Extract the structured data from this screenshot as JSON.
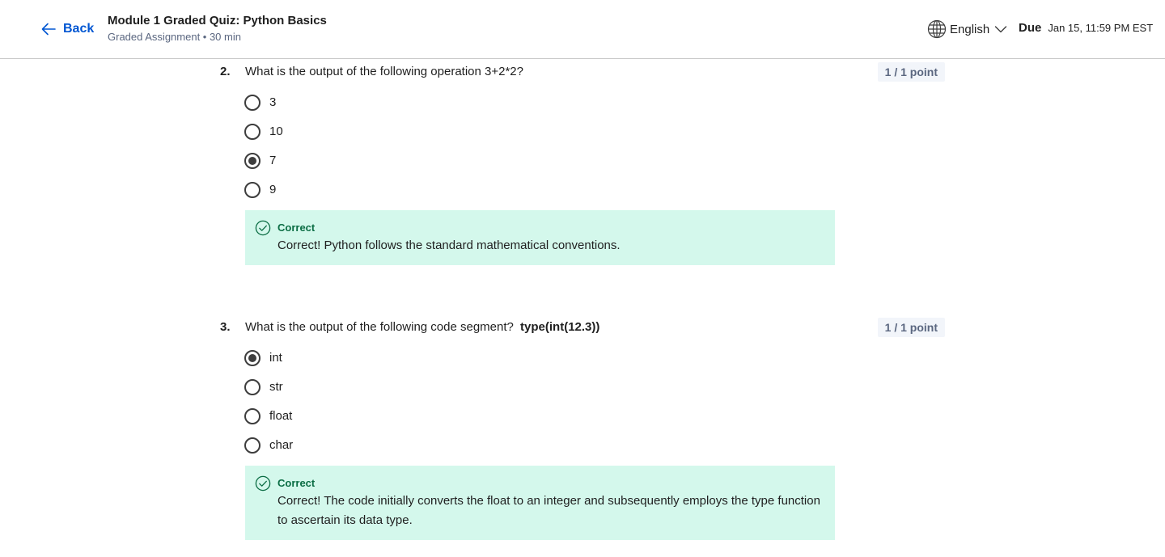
{
  "header": {
    "back_label": "Back",
    "title": "Module 1 Graded Quiz: Python Basics",
    "subtitle": "Graded Assignment • 30 min",
    "language": "English",
    "due_label": "Due",
    "due_date": "Jan 15, 11:59 PM EST"
  },
  "questions": [
    {
      "number": "2.",
      "text": "What is the output of the following operation 3+2*2?",
      "code": "",
      "points": "1 / 1 point",
      "options": [
        {
          "label": "3",
          "selected": false
        },
        {
          "label": "10",
          "selected": false
        },
        {
          "label": "7",
          "selected": true
        },
        {
          "label": "9",
          "selected": false
        }
      ],
      "feedback": {
        "title": "Correct",
        "text": "Correct! Python follows the standard mathematical conventions."
      }
    },
    {
      "number": "3.",
      "text": "What is the output of the following code segment?",
      "code": "type(int(12.3))",
      "points": "1 / 1 point",
      "options": [
        {
          "label": "int",
          "selected": true
        },
        {
          "label": "str",
          "selected": false
        },
        {
          "label": "float",
          "selected": false
        },
        {
          "label": "char",
          "selected": false
        }
      ],
      "feedback": {
        "title": "Correct",
        "text": "Correct! The code initially converts the float to an integer and subsequently employs the type function to ascertain its data type."
      }
    }
  ],
  "colors": {
    "accent": "#0056d2",
    "feedback_bg": "#d4f8ec",
    "correct_green": "#0b6d44"
  },
  "icons": {
    "back": "arrow-left-icon",
    "language": "globe-icon",
    "dropdown": "chevron-down-icon",
    "correct": "check-circle-icon"
  }
}
